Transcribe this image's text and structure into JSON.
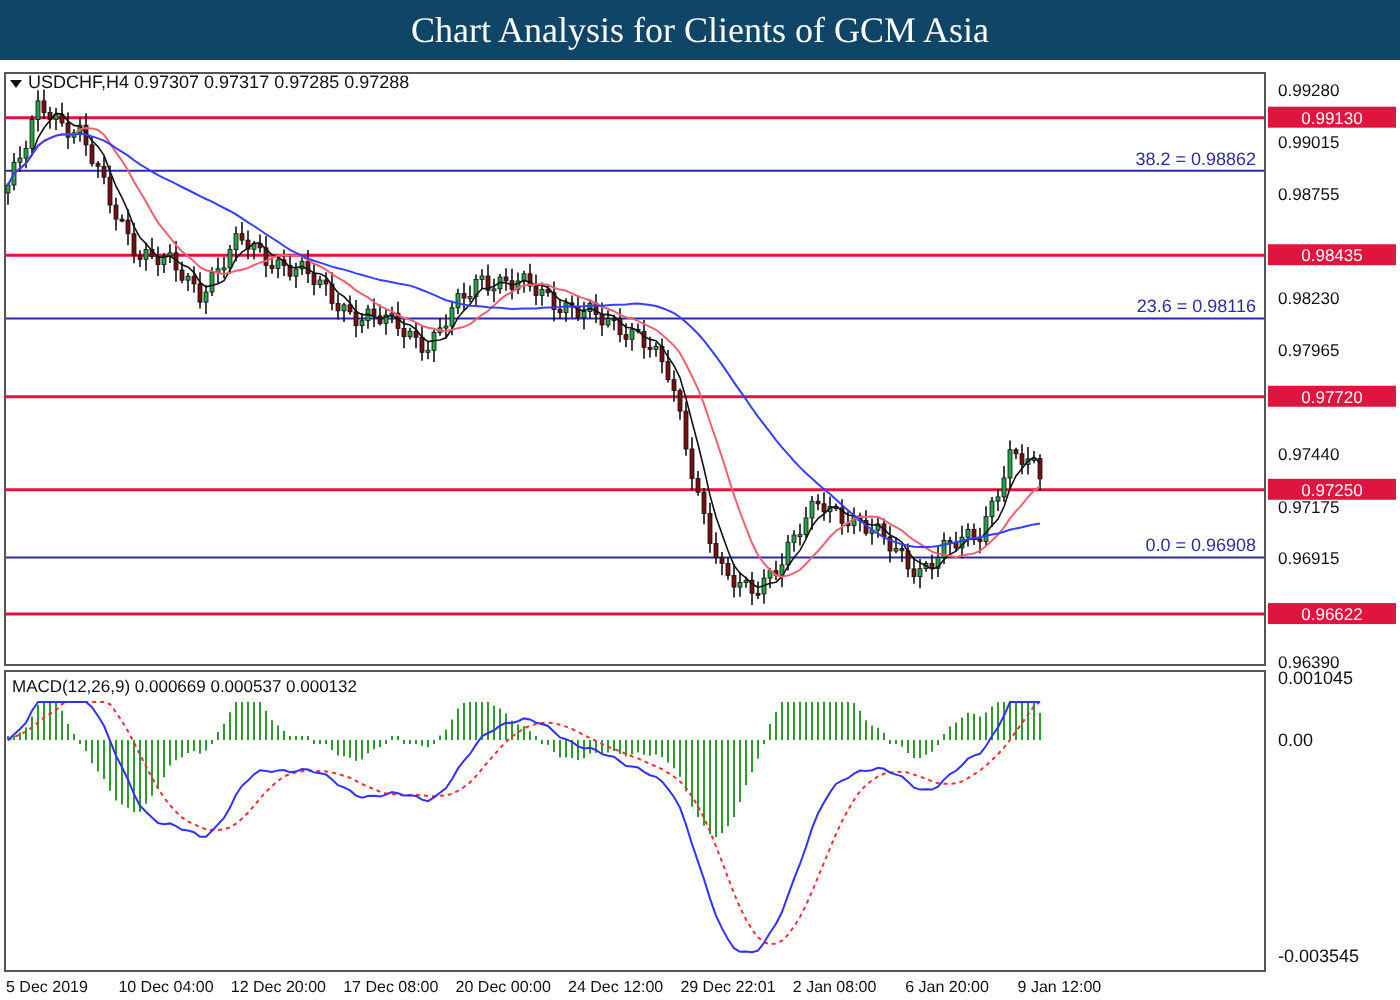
{
  "title": "Chart Analysis for Clients of GCM Asia",
  "price_chart": {
    "caption": "USDCHF,H4 0.97307 0.97317 0.97285 0.97288",
    "axis_labels": [
      "0.99280",
      "0.99015",
      "0.98755",
      "0.98230",
      "0.97965",
      "0.97440",
      "0.97175",
      "0.96915",
      "0.96390"
    ],
    "price_lines": [
      "0.99130",
      "0.98435",
      "0.97720",
      "0.97250",
      "0.96622"
    ],
    "fibonacci_lines": [
      "38.2 = 0.98862",
      "23.6 = 0.98116",
      "0.0 = 0.96908"
    ]
  },
  "macd": {
    "caption": "MACD(12,26,9) 0.000669 0.000537 0.000132",
    "axis_labels": [
      "0.001045",
      "0.00",
      "-0.003545"
    ]
  },
  "time_axis": [
    "5 Dec 2019",
    "10 Dec 04:00",
    "12 Dec 20:00",
    "17 Dec 08:00",
    "20 Dec 00:00",
    "24 Dec 12:00",
    "29 Dec 22:01",
    "2 Jan 08:00",
    "6 Jan 20:00",
    "9 Jan 12:00"
  ]
}
